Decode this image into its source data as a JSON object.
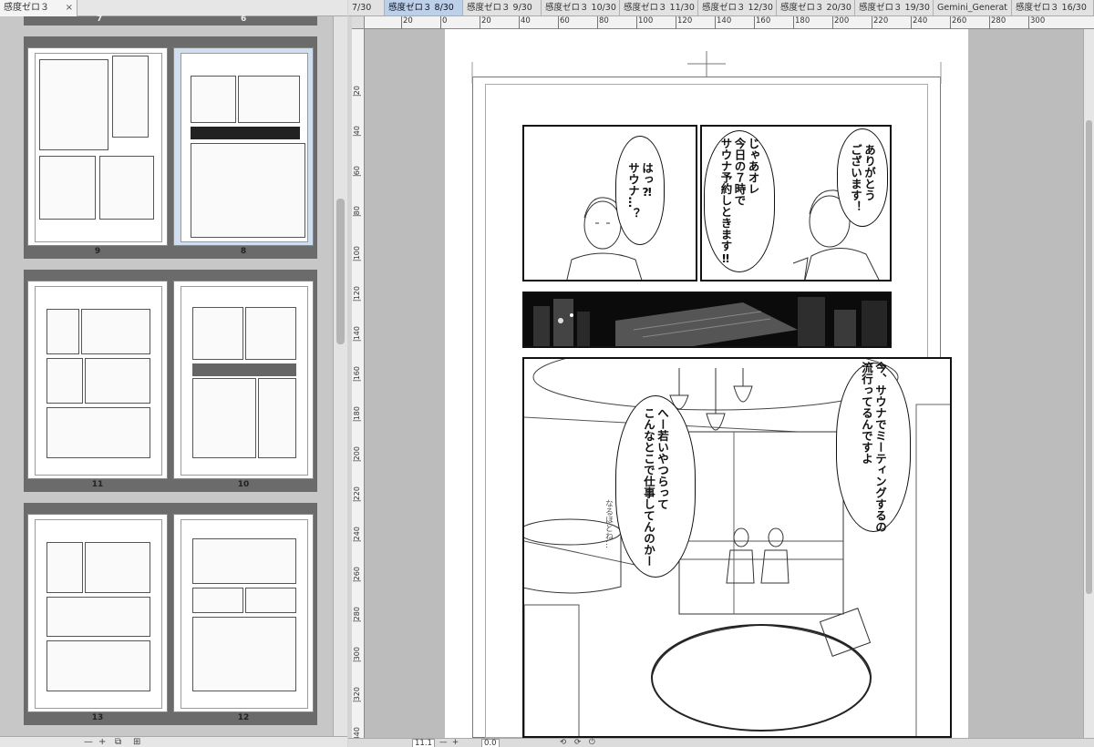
{
  "left_panel": {
    "tab_label": "感度ゼロ３",
    "tab_close": "×",
    "top_page_numbers": [
      "7",
      "6"
    ],
    "page_labels": [
      "9",
      "8",
      "11",
      "10",
      "13",
      "12"
    ],
    "bottom_tools": [
      "—",
      "+",
      "⧉",
      "⊞"
    ]
  },
  "tabs": [
    {
      "label": "7/30",
      "active": false
    },
    {
      "label": "感度ゼロ３ 8/30",
      "active": true
    },
    {
      "label": "感度ゼロ３  9/30",
      "active": false
    },
    {
      "label": "感度ゼロ３ 10/30",
      "active": false
    },
    {
      "label": "感度ゼロ３ 11/30",
      "active": false
    },
    {
      "label": "感度ゼロ３ 12/30",
      "active": false
    },
    {
      "label": "感度ゼロ３ 20/30",
      "active": false
    },
    {
      "label": "感度ゼロ３ 19/30",
      "active": false
    },
    {
      "label": "Gemini_Generat",
      "active": false
    },
    {
      "label": "感度ゼロ３ 16/30",
      "active": false
    }
  ],
  "ruler": {
    "h_ticks": [
      "20",
      "0",
      "20",
      "40",
      "60",
      "80",
      "100",
      "120",
      "140",
      "160",
      "180",
      "200",
      "220",
      "240",
      "260",
      "280",
      "300"
    ],
    "v_ticks": [
      "20",
      "40",
      "60",
      "80",
      "100",
      "120",
      "140",
      "160",
      "180",
      "200",
      "220",
      "240",
      "260",
      "280",
      "300",
      "320",
      "340"
    ]
  },
  "manga": {
    "bubbles": [
      "ありがとう\nございます！",
      "じゃあオレ\n今日の７時で\nサウナ予約しときます‼",
      "はっ⁈\nサウナ…？",
      "今、サウナでミーティングするの\n流行ってるんですよ",
      "へー若いやつらって\nこんなとこで仕事してんのかー"
    ],
    "sfx": "なるほどね…"
  },
  "status": {
    "zoom": "11.1",
    "minus": "—",
    "plus": "+",
    "angle": "0.0",
    "icons": [
      "⟲",
      "⟳",
      "⏻"
    ]
  }
}
